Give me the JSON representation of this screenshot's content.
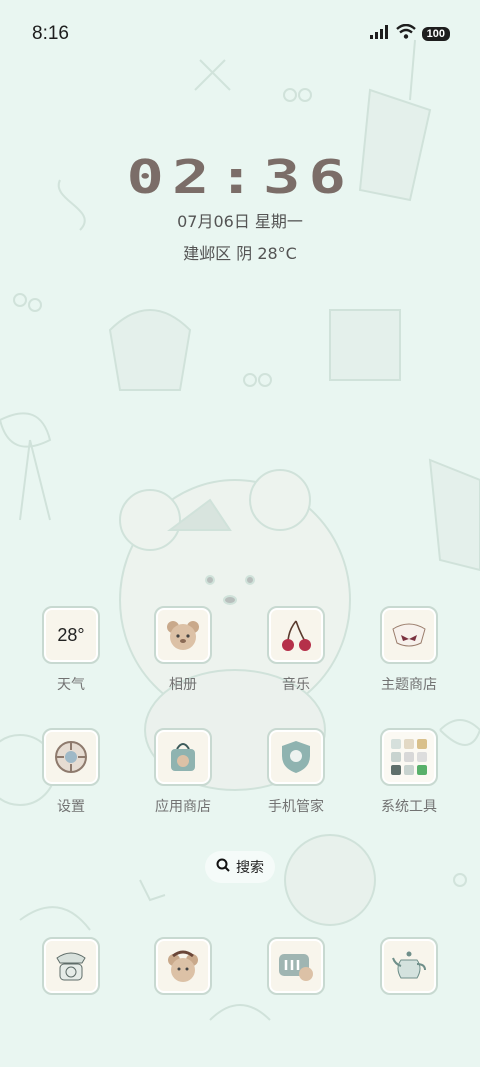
{
  "status_bar": {
    "time": "8:16",
    "battery": "100"
  },
  "clock": {
    "time": "02:36",
    "date": "07月06日 星期一",
    "weather": "建邺区 阴 28°C"
  },
  "apps_row1": [
    {
      "label": "天气",
      "icon": "weather-icon",
      "icon_text": "28°"
    },
    {
      "label": "相册",
      "icon": "bear-photo-icon"
    },
    {
      "label": "音乐",
      "icon": "cherry-icon"
    },
    {
      "label": "主题商店",
      "icon": "bow-icon"
    }
  ],
  "apps_row2": [
    {
      "label": "设置",
      "icon": "gear-icon"
    },
    {
      "label": "应用商店",
      "icon": "bag-icon"
    },
    {
      "label": "手机管家",
      "icon": "shield-icon"
    },
    {
      "label": "系统工具",
      "icon": "folder-icon"
    }
  ],
  "search": {
    "label": "搜索"
  },
  "dock": [
    {
      "icon": "telephone-icon"
    },
    {
      "icon": "bear-message-icon"
    },
    {
      "icon": "chat-icon"
    },
    {
      "icon": "teapot-icon"
    }
  ]
}
